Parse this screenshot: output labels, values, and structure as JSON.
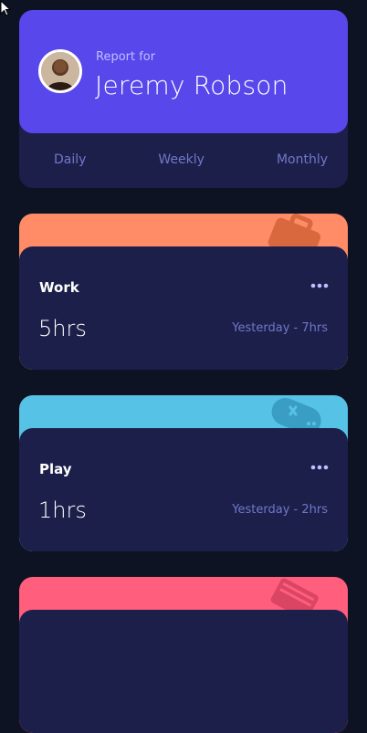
{
  "profile": {
    "report_label": "Report for",
    "name": "Jeremy Robson"
  },
  "periods": [
    {
      "label": "Daily"
    },
    {
      "label": "Weekly"
    },
    {
      "label": "Monthly"
    }
  ],
  "activities": [
    {
      "title": "Work",
      "current": "5hrs",
      "previous": "Yesterday - 7hrs",
      "color": "#ff8c66",
      "icon": "briefcase-icon"
    },
    {
      "title": "Play",
      "current": "1hrs",
      "previous": "Yesterday - 2hrs",
      "color": "#56c2e6",
      "icon": "gamepad-icon"
    },
    {
      "title": "",
      "current": "",
      "previous": "",
      "color": "#ff5e7d",
      "icon": "book-icon"
    }
  ],
  "colors": {
    "page_background": "#0e1323",
    "card_background": "#1c1f4a",
    "profile_accent": "#5847eb",
    "muted_text": "#7078c9"
  }
}
